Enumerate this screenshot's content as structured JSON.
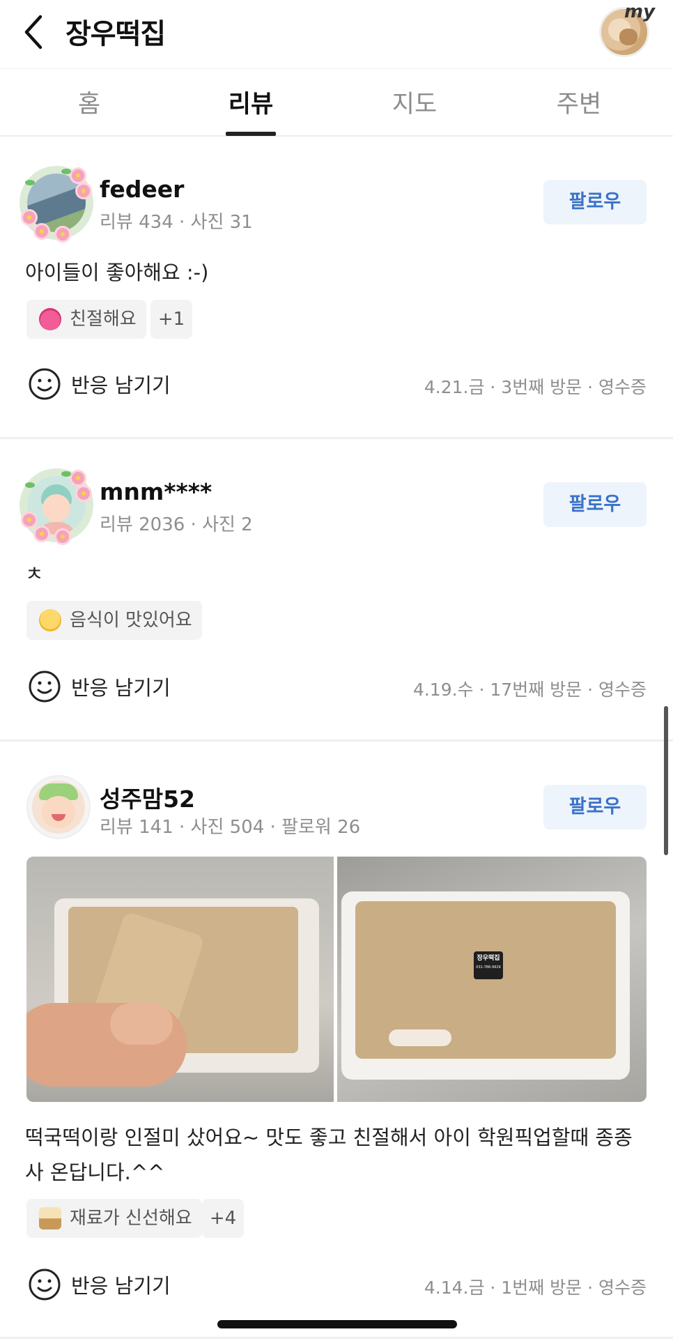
{
  "header": {
    "title": "장우떡집",
    "my_label": "my"
  },
  "tabs": [
    {
      "label": "홈"
    },
    {
      "label": "리뷰"
    },
    {
      "label": "지도"
    },
    {
      "label": "주변"
    }
  ],
  "reviews": [
    {
      "name": "fedeer",
      "meta": "리뷰 434 · 사진 31",
      "follow": "팔로우",
      "text": "아이들이 좋아해요 :-)",
      "tag": "친절해요",
      "tag_icon": "heart-face-icon",
      "extra": "+1",
      "react": "반응 남기기",
      "visit": "4.21.금 · 3번째 방문 · 영수증"
    },
    {
      "name": "mnm****",
      "meta": "리뷰 2036 · 사진 2",
      "follow": "팔로우",
      "text": "ㅊ",
      "tag": "음식이 맛있어요",
      "tag_icon": "yummy-face-icon",
      "react": "반응 남기기",
      "visit": "4.19.수 · 17번째 방문 · 영수증"
    },
    {
      "name": "성주맘52",
      "meta": "리뷰 141 · 사진 504 · 팔로워 26",
      "follow": "팔로우",
      "text": "떡국떡이랑 인절미 샀어요~ 맛도 좋고 친절해서 아이 학원픽업할때 종종 사 온답니다.^^",
      "tag": "재료가 신선해요",
      "tag_icon": "ingredients-icon",
      "extra": "+4",
      "react": "반응 남기기",
      "visit": "4.14.금 · 1번째 방문 · 영수증",
      "photo_label": "장우떡집",
      "photo_phone": "031-786-9929"
    }
  ],
  "colors": {
    "accent": "#3a72c8",
    "follow_bg": "#eef4fb"
  }
}
